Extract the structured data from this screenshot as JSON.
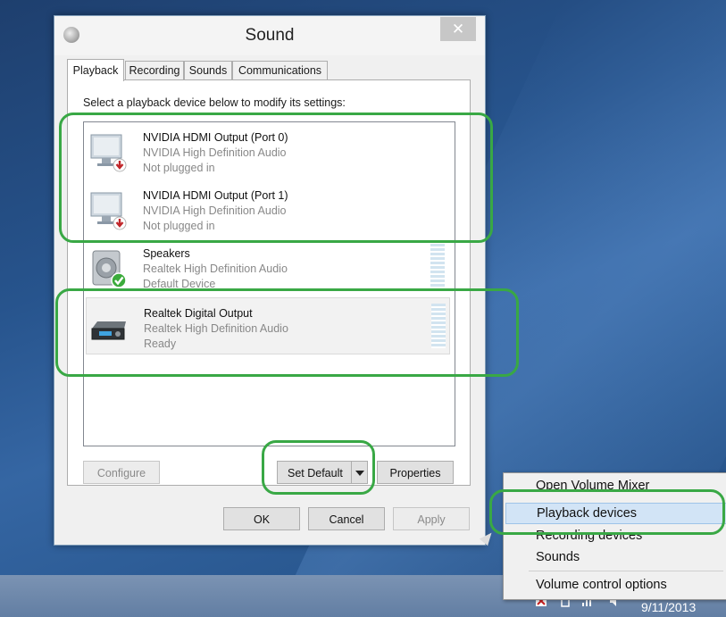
{
  "window": {
    "title": "Sound",
    "close_glyph": "✕"
  },
  "tabs": [
    {
      "label": "Playback",
      "active": true
    },
    {
      "label": "Recording",
      "active": false
    },
    {
      "label": "Sounds",
      "active": false
    },
    {
      "label": "Communications",
      "active": false
    }
  ],
  "instruction": "Select a playback device below to modify its settings:",
  "devices": [
    {
      "name": "NVIDIA HDMI Output (Port 0)",
      "driver": "NVIDIA High Definition Audio",
      "status": "Not plugged in",
      "icon": "monitor-icon",
      "badge": "unplugged-arrow-icon"
    },
    {
      "name": "NVIDIA HDMI Output (Port 1)",
      "driver": "NVIDIA High Definition Audio",
      "status": "Not plugged in",
      "icon": "monitor-icon",
      "badge": "unplugged-arrow-icon"
    },
    {
      "name": "Speakers",
      "driver": "Realtek High Definition Audio",
      "status": "Default Device",
      "icon": "speaker-icon",
      "badge": "default-check-icon"
    },
    {
      "name": "Realtek Digital Output",
      "driver": "Realtek High Definition Audio",
      "status": "Ready",
      "icon": "receiver-icon",
      "badge": ""
    }
  ],
  "buttons": {
    "configure": "Configure",
    "set_default": "Set Default",
    "properties": "Properties",
    "ok": "OK",
    "cancel": "Cancel",
    "apply": "Apply"
  },
  "context_menu": {
    "items": [
      "Open Volume Mixer",
      "Playback devices",
      "Recording devices",
      "Sounds",
      "Volume control options"
    ],
    "selected": "Playback devices"
  },
  "taskbar": {
    "clock": "9/11/2013"
  },
  "colors": {
    "highlight": "#39a845",
    "selection": "#d2e4f6"
  }
}
